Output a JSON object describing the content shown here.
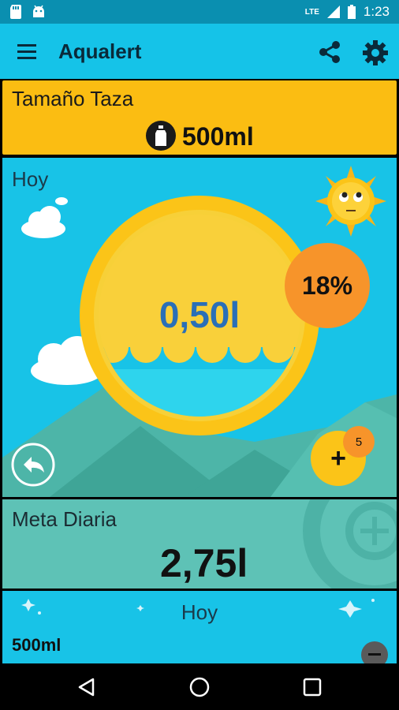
{
  "statusbar": {
    "network": "LTE",
    "time": "1:23"
  },
  "appbar": {
    "title": "Aqualert"
  },
  "cup_card": {
    "label": "Tamaño Taza",
    "value": "500ml"
  },
  "today_card": {
    "label": "Hoy",
    "amount": "0,50l",
    "percent": "18%",
    "add_badge": "5"
  },
  "goal_card": {
    "label": "Meta Diaria",
    "value": "2,75l"
  },
  "history_card": {
    "label": "Hoy",
    "entry_amount": "500ml",
    "entry_time": ""
  },
  "colors": {
    "accent": "#15c3e8",
    "cup": "#fbbd12",
    "goal": "#5ec2b6",
    "percent_badge": "#f7942a"
  }
}
